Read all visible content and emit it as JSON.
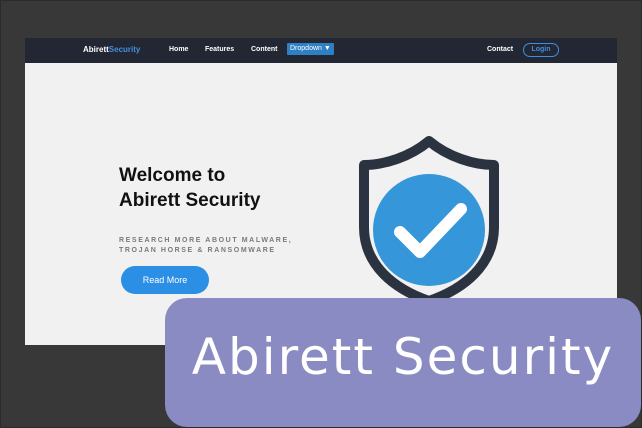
{
  "navbar": {
    "brand_main": "Abirett",
    "brand_accent": "Security",
    "links": {
      "home": "Home",
      "features": "Features",
      "content": "Content",
      "dropdown": "Dropdown ▼",
      "contact": "Contact"
    },
    "login_label": "Login"
  },
  "hero": {
    "title_line1": "Welcome to",
    "title_line2": "Abirett Security",
    "subtitle_line1": "RESEARCH MORE ABOUT MALWARE,",
    "subtitle_line2": "TROJAN HORSE & RANSOMWARE",
    "cta_label": "Read More",
    "illustration_icon": "shield-check-icon"
  },
  "overlay": {
    "title": "Abirett Security"
  },
  "colors": {
    "navbar_bg": "#232733",
    "accent_blue": "#2b8fe6",
    "shield_outline": "#2c3340",
    "shield_circle": "#3596d9",
    "overlay_bg": "#8a8bc2"
  }
}
